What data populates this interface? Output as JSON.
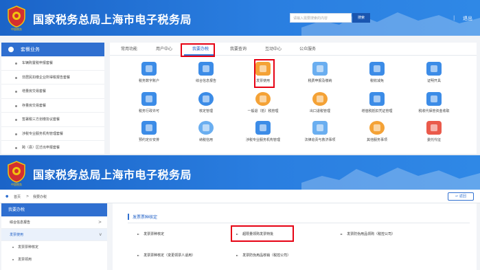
{
  "site": {
    "emblem_text": "中国税务",
    "title": "国家税务总局上海市电子税务局",
    "search_placeholder": "请输入需要搜索的内容",
    "search_button": "搜索",
    "separator": "|",
    "logout": "退出"
  },
  "panel1": {
    "sidebar": {
      "title": "套餐业务",
      "items": [
        "车辆购置税申报套餐",
        "非居民扣缴企业所得税报告套餐",
        "增量房交易套餐",
        "存量房交易套餐",
        "签署税三方划缴协议套餐",
        "涉税专业服务机构管理套餐",
        "跨（县）区迁出申报套餐"
      ]
    },
    "tabs": [
      "常用功能",
      "用户中心",
      "我要办税",
      "我要查询",
      "互动中心",
      "公众服务"
    ],
    "services": [
      "税务数字账户",
      "综合信息报告",
      "发票使用",
      "税费申报及缴纳",
      "税收减免",
      "证明开具",
      "税务行政许可",
      "核定管理",
      "一般退（抵）税管理",
      "出口退税管理",
      "增值税抵扣凭证管理",
      "税收代保管资金收取",
      "预约定价安排",
      "纳税信用",
      "涉税专业服务机构管理",
      "法律追责与救济事项",
      "其他服务事项",
      "委托代征"
    ]
  },
  "panel2": {
    "breadcrumb": {
      "home": "首页",
      "sep": ">",
      "current": "我要办税"
    },
    "back_button": "返回",
    "sidebar": {
      "title": "我要办税",
      "items": [
        "综合信息报告",
        "发票使用"
      ],
      "item_chevrons": [
        ">",
        "v"
      ],
      "subitems": [
        "发票票种核定",
        "发票领用"
      ]
    },
    "section_title": "发票票种核定",
    "bullet": "►",
    "links": [
      "发票票种核定",
      "超限量领购发票特批",
      "发票防伪用品领购（税控公司）",
      "发票票种核定（变更领票人适用）",
      "发票防伪用品核销（税控公司）"
    ]
  }
}
